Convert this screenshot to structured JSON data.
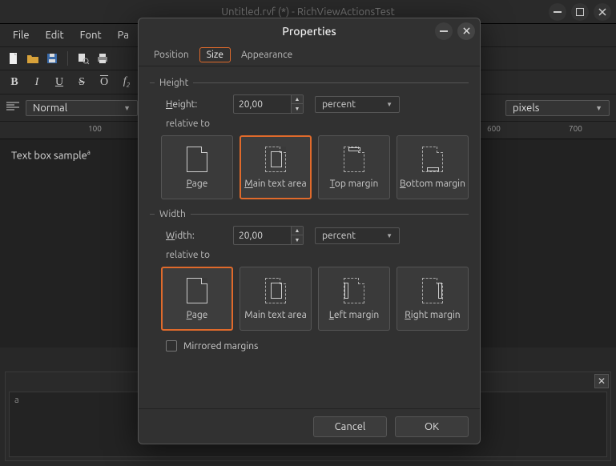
{
  "main": {
    "title": "Untitled.rvf (*) - RichViewActionsTest",
    "menu": [
      "File",
      "Edit",
      "Font",
      "Pa"
    ],
    "style_combo": "Normal",
    "units_combo": "pixels",
    "ruler_ticks": [
      "100",
      "600",
      "700"
    ],
    "textbox_text": "Text box sample",
    "bottom_caret": "a"
  },
  "dialog": {
    "title": "Properties",
    "tabs": {
      "position": "Position",
      "size": "Size",
      "appearance": "Appearance"
    },
    "height": {
      "section": "Height",
      "label_pre": "H",
      "label_rest": "eight:",
      "value": "20,00",
      "unit": "percent",
      "relative": "relative to",
      "opts": {
        "page": {
          "pre": "P",
          "rest": "age"
        },
        "main": {
          "pre": "M",
          "rest": "ain text area"
        },
        "top": {
          "pre": "T",
          "rest": "op margin"
        },
        "bot": {
          "pre": "B",
          "rest": "ottom margin"
        }
      }
    },
    "width": {
      "section": "Width",
      "label_pre": "W",
      "label_rest": "idth:",
      "value": "20,00",
      "unit": "percent",
      "relative": "relative to",
      "opts": {
        "page": {
          "pre": "P",
          "rest": "age"
        },
        "main": {
          "txt": "Main text area"
        },
        "left": {
          "pre": "L",
          "rest": "eft margin"
        },
        "right": {
          "pre": "R",
          "rest": "ight margin"
        }
      }
    },
    "mirrored": "Mirrored margins",
    "cancel": "Cancel",
    "ok": "OK"
  }
}
